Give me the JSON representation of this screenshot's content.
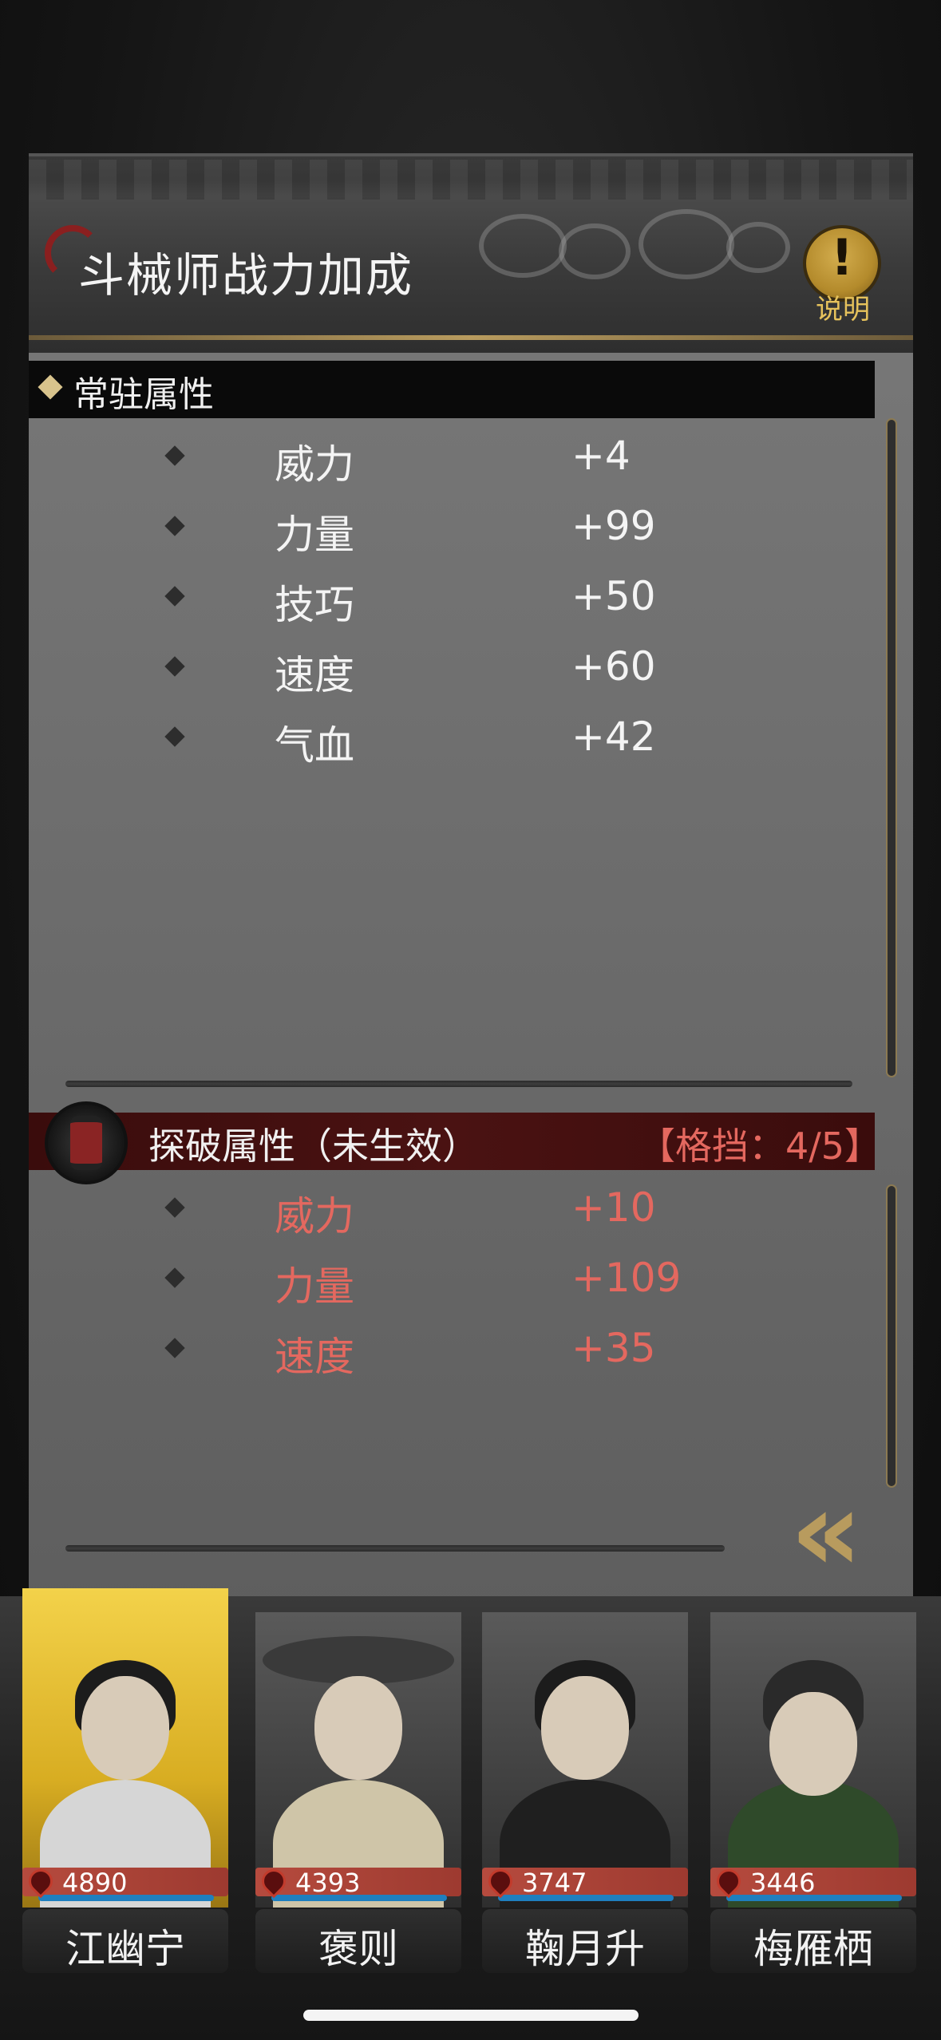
{
  "header": {
    "title": "斗械师战力加成",
    "help_label": "说明",
    "help_glyph": "!"
  },
  "standing": {
    "title": "常驻属性",
    "rows": [
      {
        "label": "威力",
        "value": "+4"
      },
      {
        "label": "力量",
        "value": "+99"
      },
      {
        "label": "技巧",
        "value": "+50"
      },
      {
        "label": "速度",
        "value": "+60"
      },
      {
        "label": "气血",
        "value": "+42"
      }
    ]
  },
  "breakthrough": {
    "title": "探破属性（未生效）",
    "block": "【格挡：4/5】",
    "rows": [
      {
        "label": "威力",
        "value": "+10"
      },
      {
        "label": "力量",
        "value": "+109"
      },
      {
        "label": "速度",
        "value": "+35"
      }
    ]
  },
  "collapse_glyph": "«",
  "roster": [
    {
      "name": "江幽宁",
      "power": "4890",
      "selected": true
    },
    {
      "name": "褒则",
      "power": "4393",
      "selected": false
    },
    {
      "name": "鞠月升",
      "power": "3747",
      "selected": false
    },
    {
      "name": "梅雁栖",
      "power": "3446",
      "selected": false
    }
  ],
  "colors": {
    "accent_gold": "#b89b5e",
    "inactive_red": "#e4685f",
    "selected_glow": "#f3d24a"
  }
}
